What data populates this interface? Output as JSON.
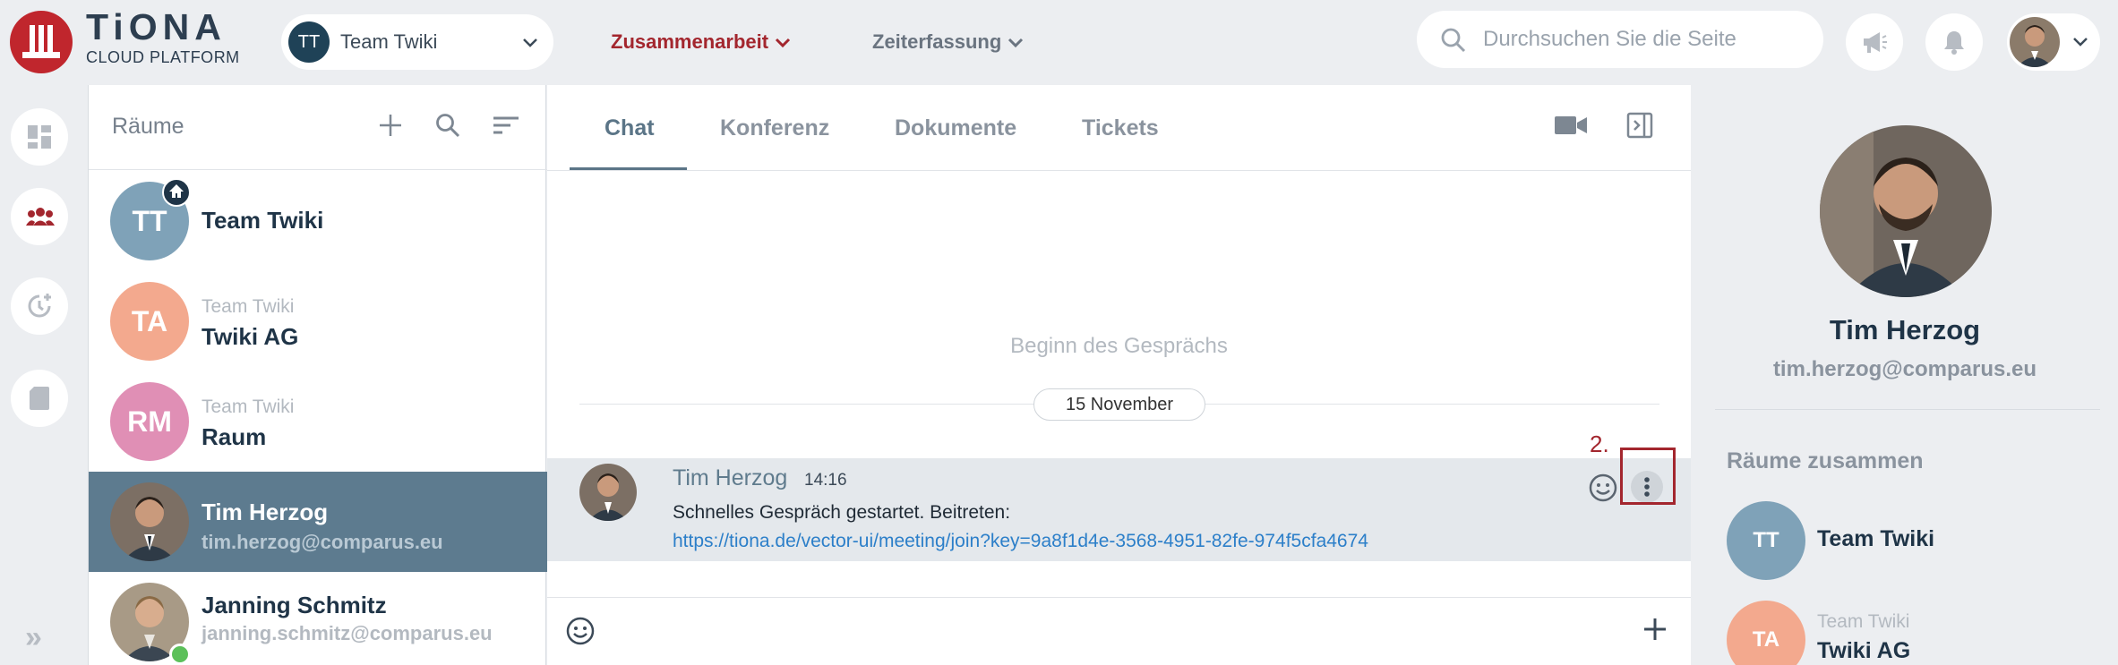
{
  "brand": {
    "title": "TiONA",
    "subtitle": "CLOUD PLATFORM",
    "color": "#c0262d"
  },
  "team_select": {
    "initials": "TT",
    "label": "Team Twiki"
  },
  "nav": {
    "collaboration": "Zusammenarbeit",
    "time_tracking": "Zeiterfassung"
  },
  "search": {
    "placeholder": "Durchsuchen Sie die Seite"
  },
  "rooms_panel": {
    "title": "Räume",
    "rooms": [
      {
        "initials": "TT",
        "team": "",
        "name": "Team Twiki",
        "email": "",
        "color": "#7fa2b8"
      },
      {
        "initials": "TA",
        "team": "Team Twiki",
        "name": "Twiki AG",
        "email": "",
        "color": "#f3a98e"
      },
      {
        "initials": "RM",
        "team": "Team Twiki",
        "name": "Raum",
        "email": "",
        "color": "#e08fb5"
      },
      {
        "initials": "",
        "team": "",
        "name": "Tim Herzog",
        "email": "tim.herzog@comparus.eu",
        "color": "#5d7b8f"
      },
      {
        "initials": "",
        "team": "",
        "name": "Janning Schmitz",
        "email": "janning.schmitz@comparus.eu",
        "color": ""
      }
    ]
  },
  "tabs": {
    "chat": "Chat",
    "conference": "Konferenz",
    "documents": "Dokumente",
    "tickets": "Tickets"
  },
  "chat": {
    "conversation_start": "Beginn des Gesprächs",
    "date": "15 November",
    "message": {
      "sender": "Tim Herzog",
      "time": "14:16",
      "text": "Schnelles Gespräch gestartet. Beitreten:",
      "link": "https://tiona.de/vector-ui/meeting/join?key=9a8f1d4e-3568-4951-82fe-974f5cfa4674"
    },
    "step_label": "2."
  },
  "profile": {
    "name": "Tim Herzog",
    "email": "tim.herzog@comparus.eu",
    "shared_rooms_title": "Räume zusammen",
    "shared_rooms": [
      {
        "initials": "TT",
        "team": "",
        "name": "Team Twiki",
        "color": "#7fa2b8"
      },
      {
        "initials": "TA",
        "team": "Team Twiki",
        "name": "Twiki AG",
        "color": "#f3a98e"
      }
    ]
  },
  "icons": [
    "search-icon",
    "megaphone-icon",
    "bell-icon",
    "chevron-down-icon",
    "dashboard-icon",
    "team-icon",
    "time-add-icon",
    "sd-card-icon",
    "double-chevron-right-icon",
    "plus-icon",
    "sort-icon",
    "video-icon",
    "panel-icon",
    "emoji-icon",
    "more-vertical-icon",
    "home-icon"
  ]
}
